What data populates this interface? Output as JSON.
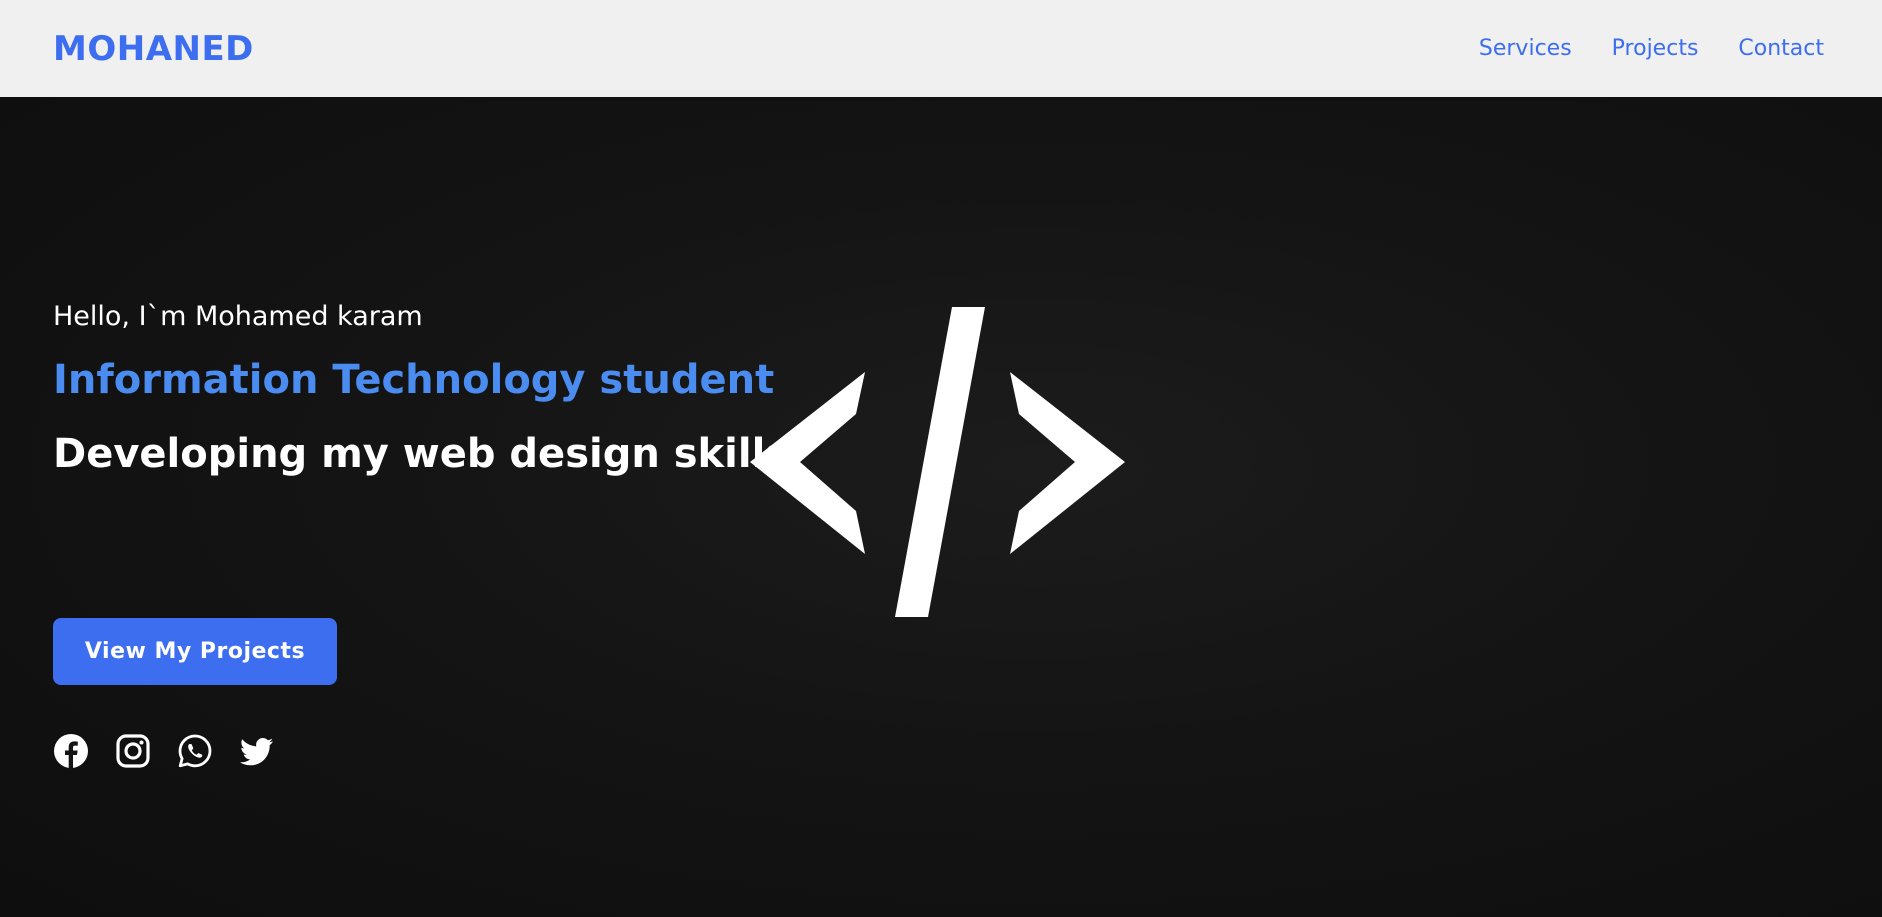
{
  "navbar": {
    "logo": "MOHANED",
    "links": [
      {
        "label": "Services"
      },
      {
        "label": "Projects"
      },
      {
        "label": "Contact"
      }
    ]
  },
  "hero": {
    "greeting": "Hello, I`m Mohamed karam",
    "role": "Information Technology student",
    "tagline": "Developing my web design skills",
    "cta_label": "View My Projects",
    "decorative_icon": "code-brackets-icon",
    "socials": [
      {
        "icon": "facebook-icon"
      },
      {
        "icon": "instagram-icon"
      },
      {
        "icon": "whatsapp-icon"
      },
      {
        "icon": "twitter-icon"
      }
    ]
  },
  "colors": {
    "accent": "#3d6ef0",
    "role_text": "#4a8cf0",
    "navbar_bg": "#f0f0f0",
    "hero_bg": "#141414"
  }
}
